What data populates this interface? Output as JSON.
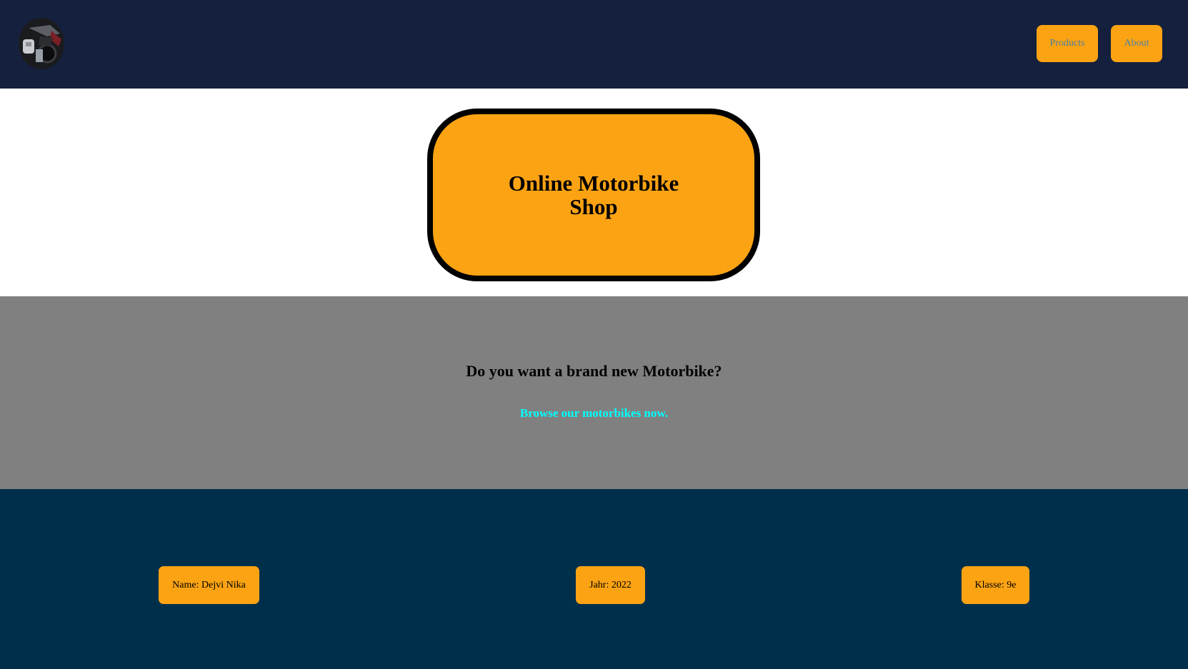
{
  "navbar": {
    "logo_icon": "motorbike-logo-icon",
    "products_label": "Products",
    "about_label": "About"
  },
  "hero": {
    "title": "Online Motorbike Shop"
  },
  "cta": {
    "question": "Do you want a brand new Motorbike?",
    "link_text": "Browse our motorbikes now."
  },
  "footer": {
    "name": "Name: Dejvi Nika",
    "year": "Jahr: 2022",
    "class": "Klasse: 9e"
  },
  "colors": {
    "navbar_bg": "#14203e",
    "accent": "#fba313",
    "cta_bg": "#808080",
    "cta_link": "#00ffff",
    "footer_bg": "#002f4b"
  }
}
